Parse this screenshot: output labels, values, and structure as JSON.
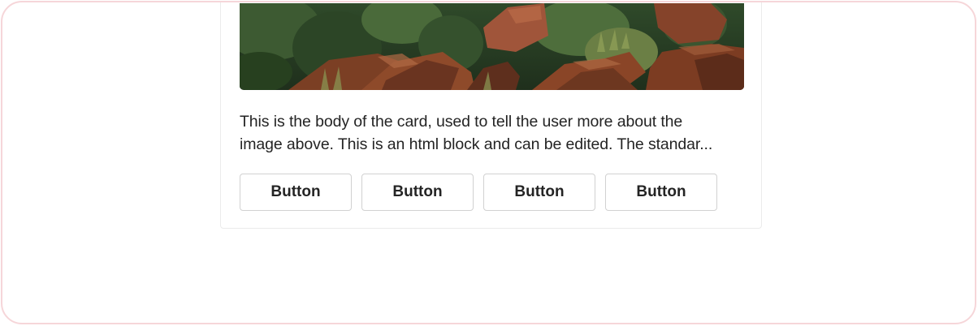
{
  "card": {
    "body_line_1": "This is the body of the card, used to tell the user more about the",
    "body_line_2": "image above. This is an html block and can be edited. The standar...",
    "buttons": [
      {
        "label": "Button"
      },
      {
        "label": "Button"
      },
      {
        "label": "Button"
      },
      {
        "label": "Button"
      }
    ]
  },
  "colors": {
    "frame_border": "#f6d6d9",
    "card_border": "#ebebeb",
    "button_border": "#d1d1d1",
    "text": "#242424"
  }
}
